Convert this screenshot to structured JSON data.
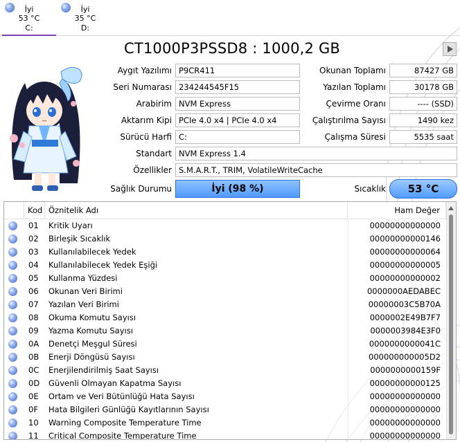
{
  "drives": [
    {
      "status": "İyi",
      "temp": "53 °C",
      "letter": "C:"
    },
    {
      "status": "İyi",
      "temp": "35 °C",
      "letter": "D:"
    }
  ],
  "title": "CT1000P3PSSD8 : 1000,2 GB",
  "left_fields": [
    {
      "label": "Aygıt Yazılımı",
      "value": "P9CR411"
    },
    {
      "label": "Seri Numarası",
      "value": "234244545F15"
    },
    {
      "label": "Arabirim",
      "value": "NVM Express"
    },
    {
      "label": "Aktarım Kipi",
      "value": "PCIe 4.0 x4 | PCIe 4.0 x4"
    },
    {
      "label": "Sürücü Harfi",
      "value": "C:"
    }
  ],
  "right_fields": [
    {
      "label": "Okunan Toplamı",
      "value": "87427 GB"
    },
    {
      "label": "Yazılan Toplamı",
      "value": "30178 GB"
    },
    {
      "label": "Çevirme Oranı",
      "value": "---- (SSD)"
    },
    {
      "label": "Çalıştırılma Sayısı",
      "value": "1490 kez"
    },
    {
      "label": "Çalışma Süresi",
      "value": "5535 saat"
    }
  ],
  "standard": {
    "label": "Standart",
    "value": "NVM Express 1.4"
  },
  "features": {
    "label": "Özellikler",
    "value": "S.M.A.R.T., TRIM, VolatileWriteCache"
  },
  "health": {
    "label": "Sağlık Durumu",
    "value": "İyi  (98 %)"
  },
  "temperature": {
    "label": "Sıcaklık",
    "value": "53 °C"
  },
  "colors": {
    "health_fill": "#5aa2ff",
    "accent_tab": "#7b3fb6"
  },
  "table": {
    "headers": {
      "code": "Kod",
      "name": "Öznitelik Adı",
      "raw": "Ham Değer"
    },
    "rows": [
      {
        "code": "01",
        "name": "Kritik Uyarı",
        "raw": "00000000000000"
      },
      {
        "code": "02",
        "name": "Birleşik Sıcaklık",
        "raw": "00000000000146"
      },
      {
        "code": "03",
        "name": "Kullanılabilecek Yedek",
        "raw": "00000000000064"
      },
      {
        "code": "04",
        "name": "Kullanılabilecek Yedek Eşiği",
        "raw": "00000000000005"
      },
      {
        "code": "05",
        "name": "Kullanma Yüzdesi",
        "raw": "00000000000002"
      },
      {
        "code": "06",
        "name": "Okunan Veri Birimi",
        "raw": "0000000AEDABEC"
      },
      {
        "code": "07",
        "name": "Yazılan Veri Birimi",
        "raw": "00000003C5B70A"
      },
      {
        "code": "08",
        "name": "Okuma Komutu Sayısı",
        "raw": "0000002E49B7F7"
      },
      {
        "code": "09",
        "name": "Yazma Komutu Sayısı",
        "raw": "0000003984E3F0"
      },
      {
        "code": "0A",
        "name": "Denetçi Meşgul Süresi",
        "raw": "0000000000041C"
      },
      {
        "code": "0B",
        "name": "Enerji Döngüsü Sayısı",
        "raw": "000000000005D2"
      },
      {
        "code": "0C",
        "name": "Enerjilendirilmiş Saat Sayısı",
        "raw": "0000000000159F"
      },
      {
        "code": "0D",
        "name": "Güvenli Olmayan Kapatma Sayısı",
        "raw": "00000000000125"
      },
      {
        "code": "0E",
        "name": "Ortam ve Veri Bütünlüğü Hata Sayısı",
        "raw": "00000000000000"
      },
      {
        "code": "0F",
        "name": "Hata Bilgileri Günlüğü Kayıtlarının Sayısı",
        "raw": "00000000000000"
      },
      {
        "code": "10",
        "name": "Warning Composite Temperature Time",
        "raw": "00000000000000"
      },
      {
        "code": "11",
        "name": "Critical Composite Temperature Time",
        "raw": "00000000000000"
      }
    ]
  }
}
